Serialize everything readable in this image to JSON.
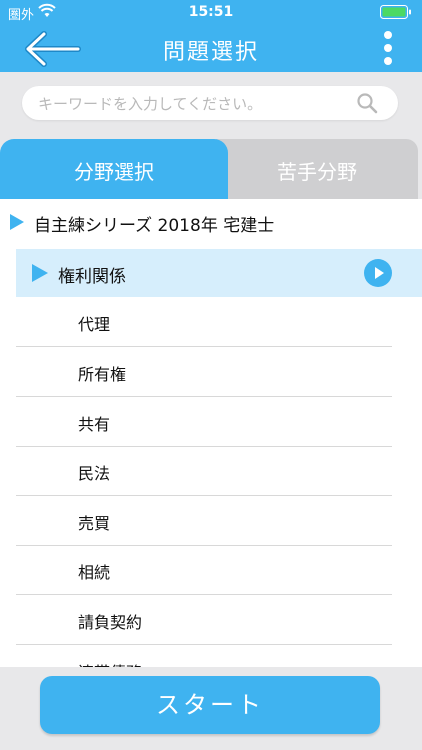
{
  "status": {
    "carrier": "圏外",
    "time": "15:51"
  },
  "header": {
    "title": "問題選択"
  },
  "search": {
    "placeholder": "キーワードを入力してください。"
  },
  "tabs": {
    "active": "分野選択",
    "inactive": "苦手分野"
  },
  "list": {
    "root": "自主練シリーズ 2018年 宅建士",
    "category": "権利関係",
    "items": [
      "代理",
      "所有権",
      "共有",
      "民法",
      "売買",
      "相続",
      "請負契約",
      "連帯債務"
    ]
  },
  "start_button": "スタート",
  "colors": {
    "accent": "#3fb3f0",
    "selected_row": "#d6eefc",
    "inactive_tab": "#cfcfd1"
  }
}
